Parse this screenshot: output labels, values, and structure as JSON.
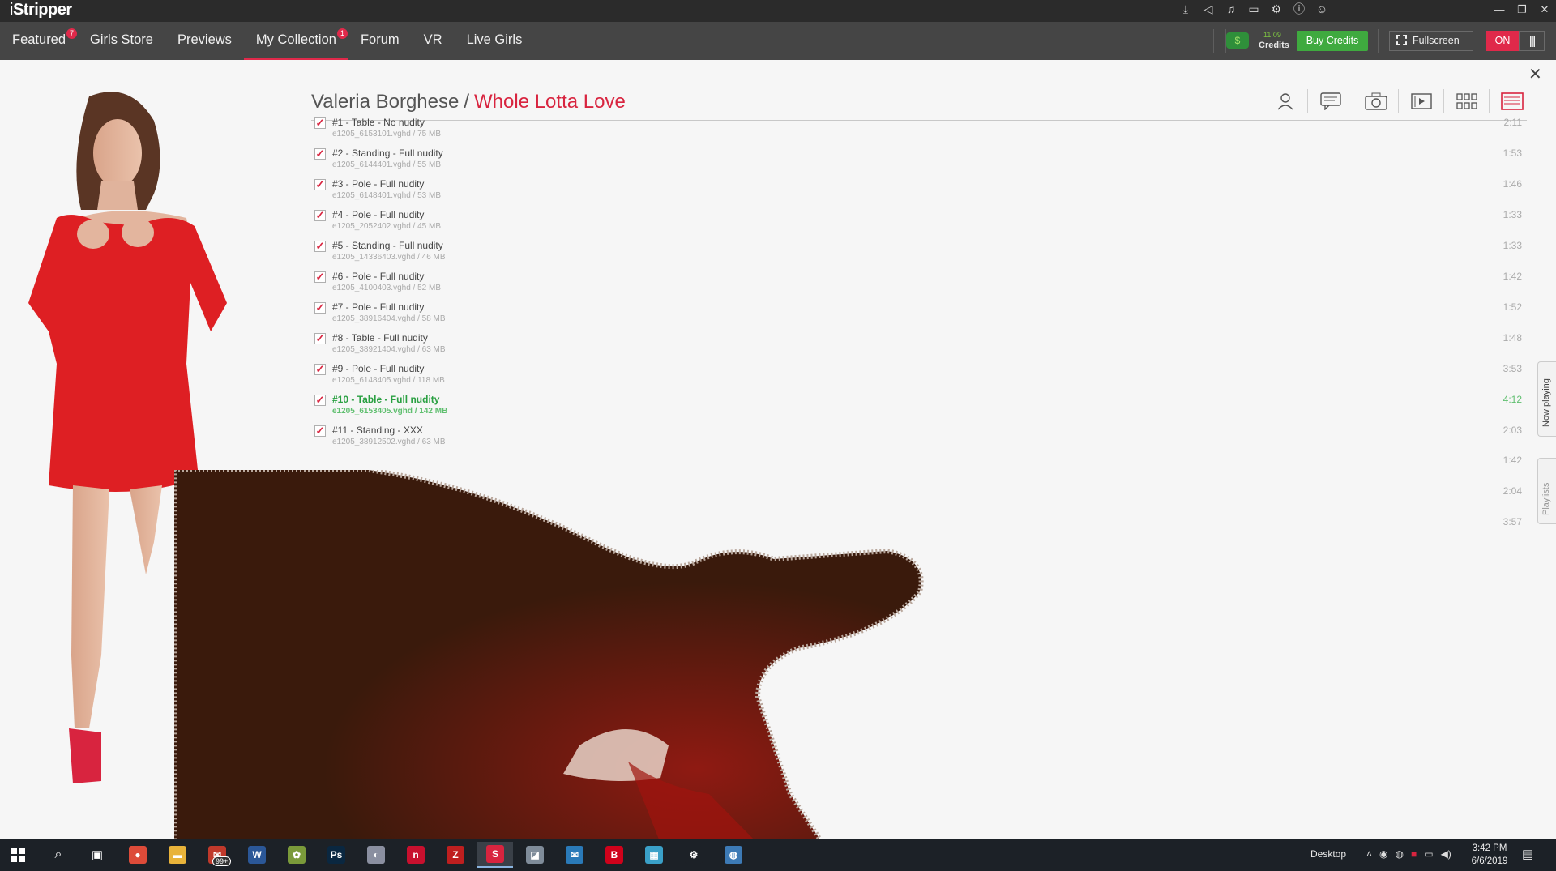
{
  "app": {
    "logo_prefix": "i",
    "logo_name": "Stripper"
  },
  "nav": {
    "tabs": [
      {
        "label": "Featured",
        "badge": "7"
      },
      {
        "label": "Girls Store",
        "badge": ""
      },
      {
        "label": "Previews",
        "badge": ""
      },
      {
        "label": "My Collection",
        "badge": "1"
      },
      {
        "label": "Forum",
        "badge": ""
      },
      {
        "label": "VR",
        "badge": ""
      },
      {
        "label": "Live Girls",
        "badge": ""
      }
    ],
    "active_tab": "My Collection",
    "credits_amount": "11.09",
    "credits_label": "Credits",
    "buy_label": "Buy Credits",
    "fullscreen_label": "Fullscreen",
    "toggle_label": "ON"
  },
  "page": {
    "model_name": "Valeria Borghese",
    "separator": "/",
    "scene_title": "Whole Lotta Love"
  },
  "tracks": [
    {
      "title": "#1 - Table - No nudity",
      "meta": "e1205_6153101.vghd / 75 MB",
      "duration": "2:11",
      "checked": true,
      "playing": false
    },
    {
      "title": "#2 - Standing - Full nudity",
      "meta": "e1205_6144401.vghd / 55 MB",
      "duration": "1:53",
      "checked": true,
      "playing": false
    },
    {
      "title": "#3 - Pole - Full nudity",
      "meta": "e1205_6148401.vghd / 53 MB",
      "duration": "1:46",
      "checked": true,
      "playing": false
    },
    {
      "title": "#4 - Pole - Full nudity",
      "meta": "e1205_2052402.vghd / 45 MB",
      "duration": "1:33",
      "checked": true,
      "playing": false
    },
    {
      "title": "#5 - Standing - Full nudity",
      "meta": "e1205_14336403.vghd / 46 MB",
      "duration": "1:33",
      "checked": true,
      "playing": false
    },
    {
      "title": "#6 - Pole - Full nudity",
      "meta": "e1205_4100403.vghd / 52 MB",
      "duration": "1:42",
      "checked": true,
      "playing": false
    },
    {
      "title": "#7 - Pole - Full nudity",
      "meta": "e1205_38916404.vghd / 58 MB",
      "duration": "1:52",
      "checked": true,
      "playing": false
    },
    {
      "title": "#8 - Table - Full nudity",
      "meta": "e1205_38921404.vghd / 63 MB",
      "duration": "1:48",
      "checked": true,
      "playing": false
    },
    {
      "title": "#9 - Pole - Full nudity",
      "meta": "e1205_6148405.vghd / 118 MB",
      "duration": "3:53",
      "checked": true,
      "playing": false
    },
    {
      "title": "#10 - Table - Full nudity",
      "meta": "e1205_6153405.vghd / 142 MB",
      "duration": "4:12",
      "checked": true,
      "playing": true
    },
    {
      "title": "#11 - Standing - XXX",
      "meta": "e1205_38912502.vghd / 63 MB",
      "duration": "2:03",
      "checked": true,
      "playing": false
    }
  ],
  "extra_durations": [
    "1:42",
    "2:04",
    "3:57"
  ],
  "side_tabs": {
    "now_playing": "Now playing",
    "playlists": "Playlists"
  },
  "taskbar": {
    "desktop_label": "Desktop",
    "time": "3:42 PM",
    "date": "6/6/2019",
    "badge": "99+",
    "apps": [
      {
        "name": "chrome",
        "color": "#dd4b39",
        "glyph": "●"
      },
      {
        "name": "file-explorer",
        "color": "#e8b33a",
        "glyph": "▬"
      },
      {
        "name": "badge-app",
        "color": "#c0392b",
        "glyph": "✉"
      },
      {
        "name": "word",
        "color": "#2b5797",
        "glyph": "W"
      },
      {
        "name": "game",
        "color": "#7a9a3a",
        "glyph": "✿"
      },
      {
        "name": "photoshop",
        "color": "#0a2740",
        "glyph": "Ps"
      },
      {
        "name": "paint",
        "color": "#8a8fa0",
        "glyph": "◐"
      },
      {
        "name": "nero",
        "color": "#c8102e",
        "glyph": "n"
      },
      {
        "name": "filezilla",
        "color": "#bf1f1f",
        "glyph": "Z"
      },
      {
        "name": "istripper",
        "color": "#d8243f",
        "glyph": "S"
      },
      {
        "name": "viewer",
        "color": "#7f8c9a",
        "glyph": "◪"
      },
      {
        "name": "outlook",
        "color": "#2a7ab8",
        "glyph": "✉"
      },
      {
        "name": "bitdefender",
        "color": "#d0021b",
        "glyph": "B"
      },
      {
        "name": "network",
        "color": "#3aa0c8",
        "glyph": "▦"
      },
      {
        "name": "settings",
        "color": "#1c2127",
        "glyph": "⚙"
      },
      {
        "name": "globe",
        "color": "#3d7ab5",
        "glyph": "◍"
      }
    ]
  },
  "colors": {
    "accent": "#d8243f",
    "green": "#3faa3f",
    "playing": "#2aa042"
  }
}
